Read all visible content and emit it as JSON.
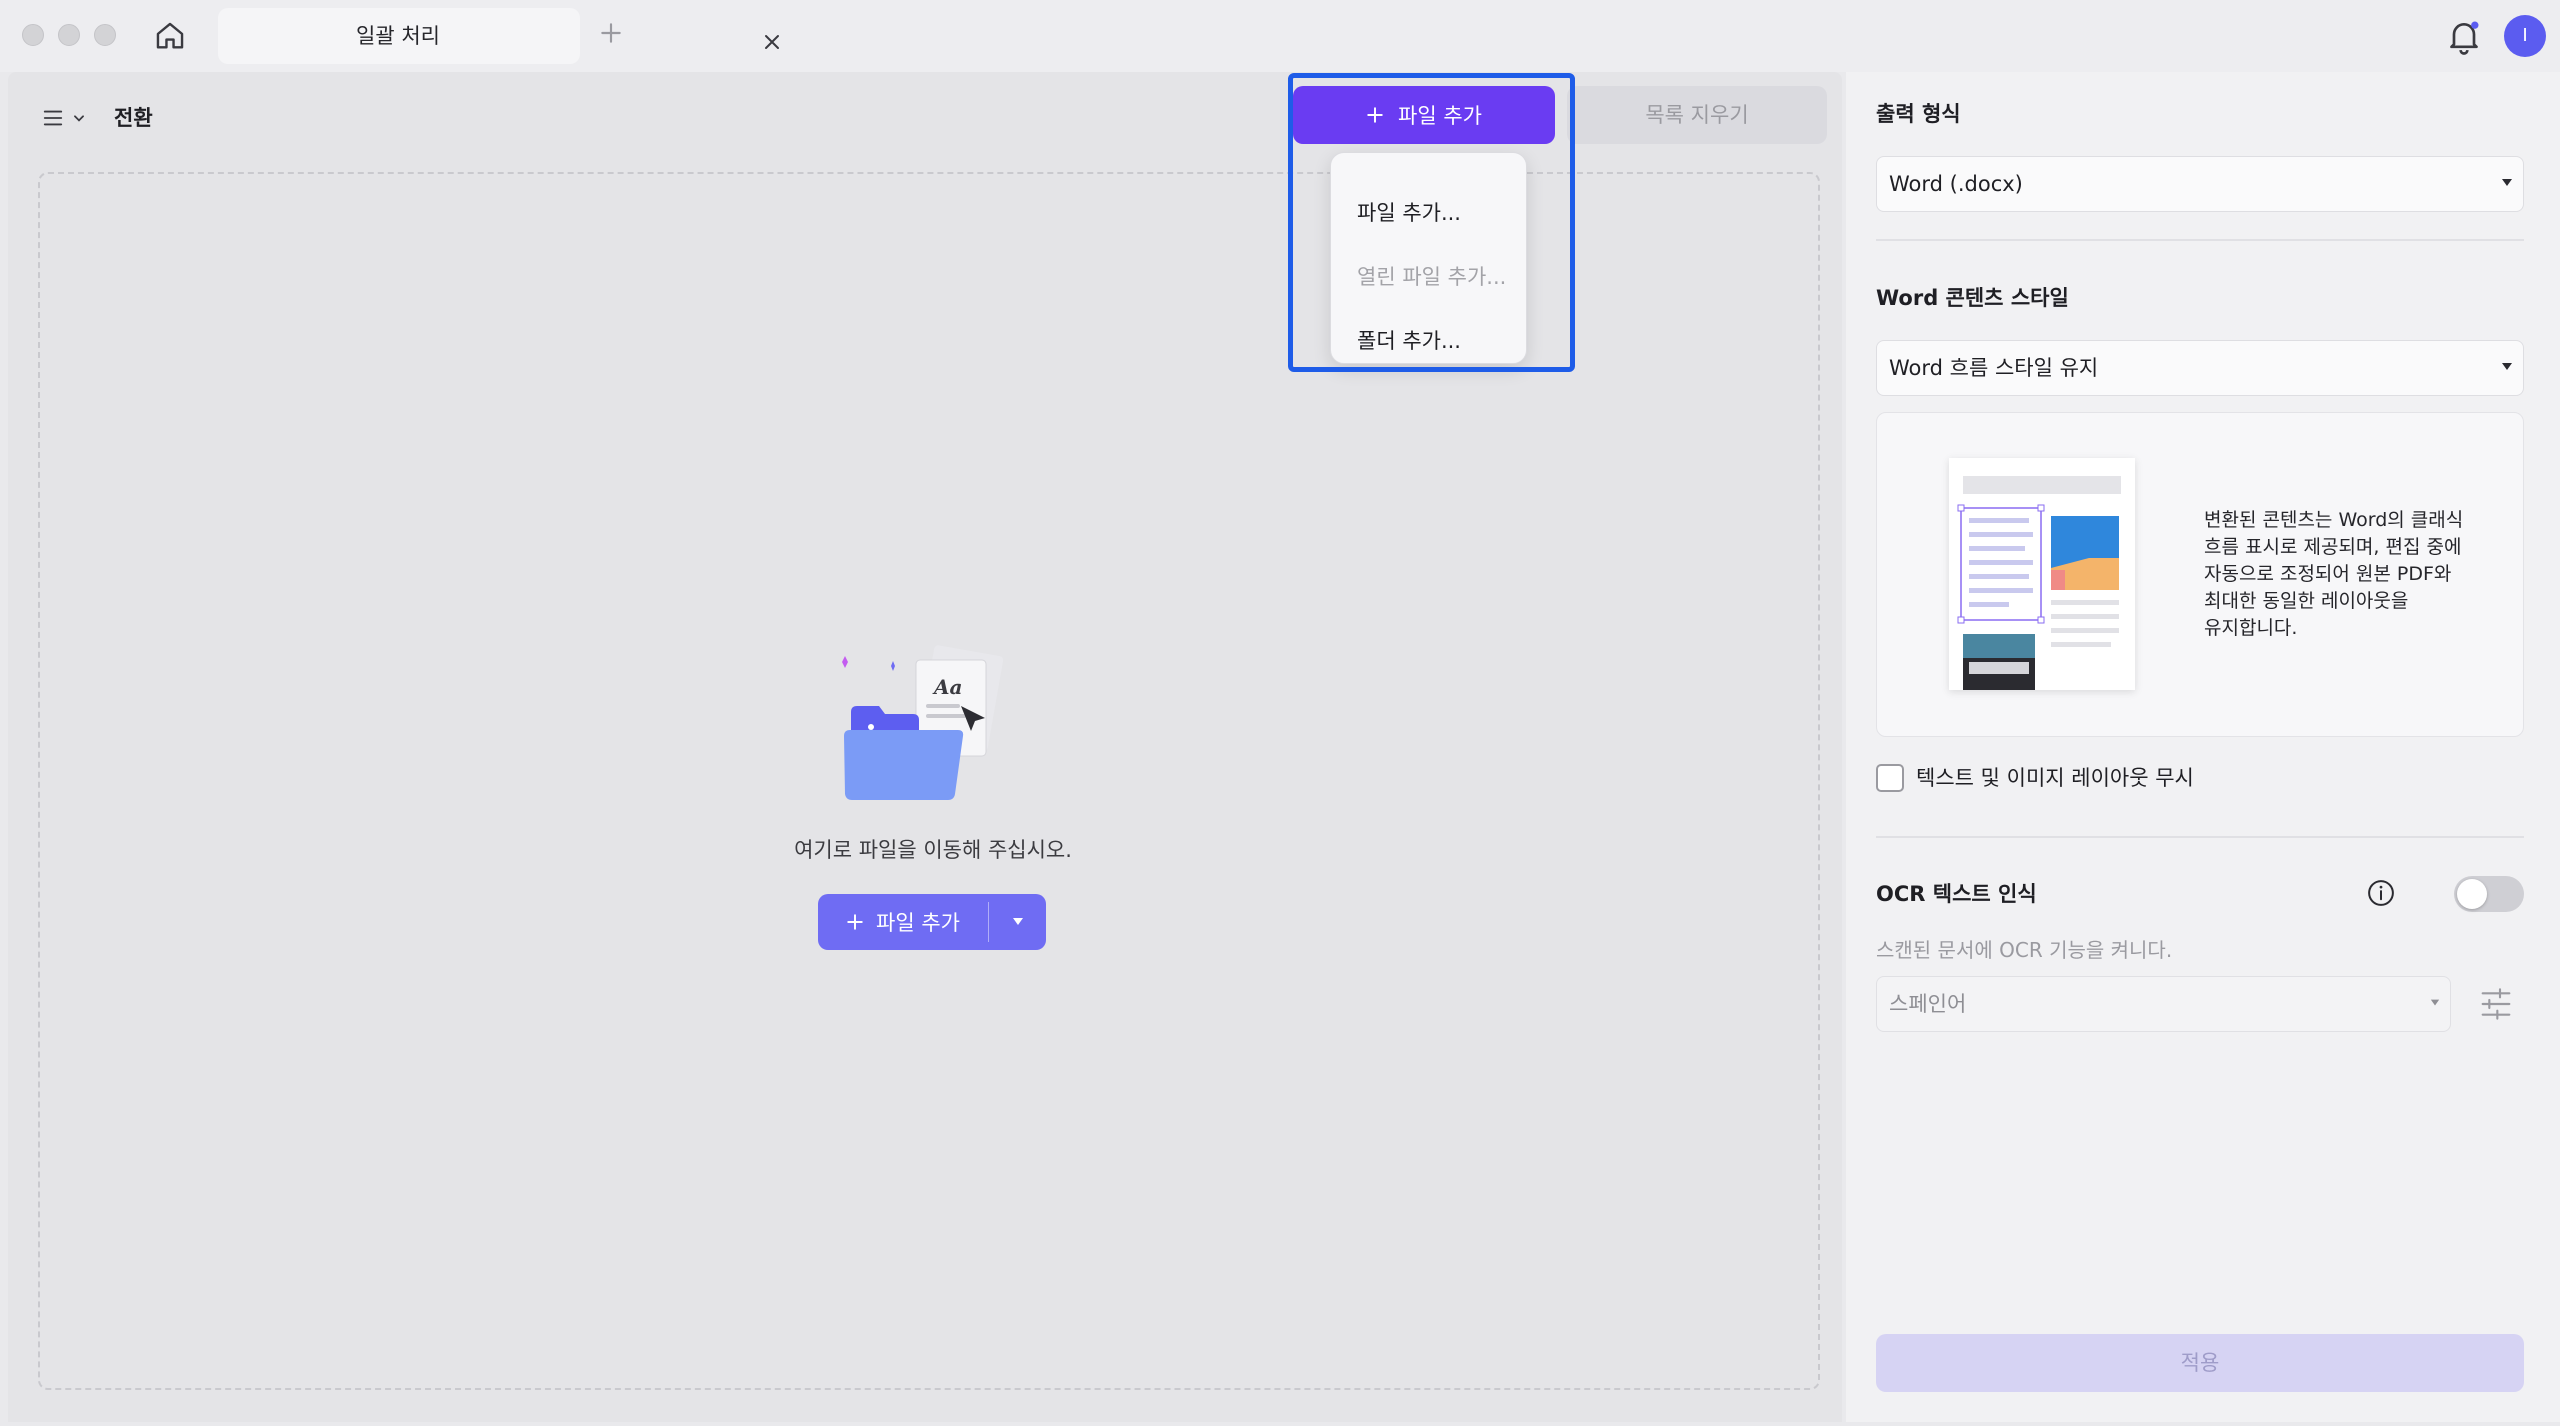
{
  "titlebar": {
    "tab_title": "일괄 처리",
    "avatar_initial": "I"
  },
  "main": {
    "breadcrumb": "전환",
    "add_file_label": "파일 추가",
    "clear_list_label": "목록 지우기",
    "add_menu": {
      "items": [
        {
          "label": "파일 추가...",
          "enabled": true
        },
        {
          "label": "열린 파일 추가...",
          "enabled": false
        },
        {
          "label": "폴더 추가...",
          "enabled": true
        }
      ]
    },
    "drop_hint": "여기로 파일을 이동해 주십시오.",
    "center_add_label": "파일 추가"
  },
  "side": {
    "output_format": {
      "heading": "출력 형식",
      "value": "Word (.docx)"
    },
    "content_style": {
      "heading": "Word 콘텐츠 스타일",
      "value": "Word 흐름 스타일 유지",
      "description": "변환된 콘텐츠는 Word의 클래식\n흐름 표시로 제공되며, 편집 중에\n자동으로 조정되어 원본 PDF와\n최대한 동일한 레이아웃을\n유지합니다."
    },
    "ignore_layout": {
      "label": "텍스트 및 이미지 레이아웃 무시",
      "checked": false
    },
    "ocr": {
      "heading": "OCR 텍스트 인식",
      "enabled": false,
      "hint": "스캔된 문서에 OCR 기능을 켜니다.",
      "language": "스페인어"
    },
    "apply_label": "적용"
  },
  "colors": {
    "accent": "#6a3cf2",
    "highlight_frame": "#1e5ce8",
    "center_button": "#6f6cf3",
    "avatar": "#5b5cf0"
  },
  "icons": [
    "home-icon",
    "close-icon",
    "plus-icon",
    "bell-icon",
    "menu-icon",
    "chevron-down-icon",
    "caret-down-icon",
    "info-icon",
    "sliders-icon",
    "folder-illustration"
  ]
}
